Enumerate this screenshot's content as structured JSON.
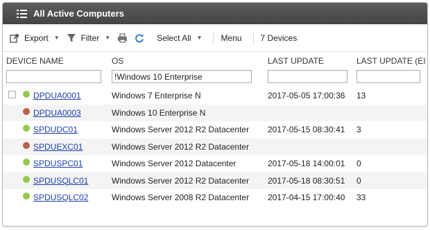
{
  "window": {
    "title": "All Active Computers"
  },
  "toolbar": {
    "export_label": "Export",
    "filter_label": "Filter",
    "select_all_label": "Select All",
    "menu_label": "Menu",
    "device_count": "7 Devices"
  },
  "columns": [
    "DEVICE NAME",
    "OS",
    "LAST UPDATE",
    "LAST UPDATE (EI"
  ],
  "filters": {
    "device": "",
    "os": "!Windows 10 Enterprise",
    "last_update": "",
    "last_update_ei": ""
  },
  "status_colors": {
    "online": "#94c94a",
    "offline": "#b9614a"
  },
  "rows": [
    {
      "name": "DPDUA0001",
      "os": "Windows 7 Enterprise N",
      "last_update": "2017-05-05 17:00:36",
      "last_update_ei": "13",
      "status": "online"
    },
    {
      "name": "DPDUA0003",
      "os": "Windows 10 Enterprise N",
      "last_update": "",
      "last_update_ei": "",
      "status": "offline"
    },
    {
      "name": "SPDUDC01",
      "os": "Windows Server 2012 R2 Datacenter",
      "last_update": "2017-05-15 08:30:41",
      "last_update_ei": "3",
      "status": "online"
    },
    {
      "name": "SPDUEXC01",
      "os": "Windows Server 2012 R2 Datacenter",
      "last_update": "",
      "last_update_ei": "",
      "status": "offline"
    },
    {
      "name": "SPDUSPC01",
      "os": "Windows Server 2012 Datacenter",
      "last_update": "2017-05-18 14:00:01",
      "last_update_ei": "0",
      "status": "online"
    },
    {
      "name": "SPDUSQLC01",
      "os": "Windows Server 2012 R2 Datacenter",
      "last_update": "2017-05-18 08:30:51",
      "last_update_ei": "0",
      "status": "online"
    },
    {
      "name": "SPDUSQLC02",
      "os": "Windows Server 2008 R2 Datacenter",
      "last_update": "2017-04-15 17:00:40",
      "last_update_ei": "33",
      "status": "online"
    }
  ]
}
